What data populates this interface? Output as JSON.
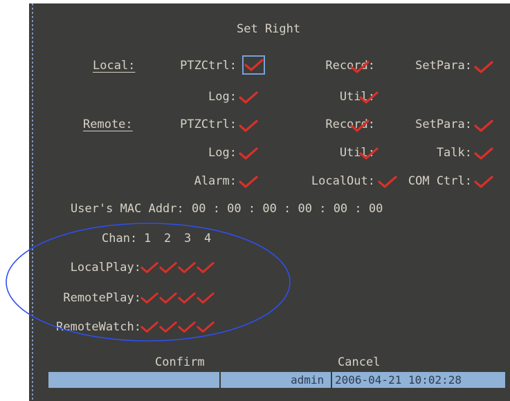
{
  "title": "Set Right",
  "local": {
    "label": "Local:",
    "ptz": "PTZCtrl:",
    "record": "Record:",
    "setpara": "SetPara:",
    "log": "Log:",
    "util": "Util:"
  },
  "remote": {
    "label": "Remote:",
    "ptz": "PTZCtrl:",
    "record": "Record:",
    "setpara": "SetPara:",
    "log": "Log:",
    "util": "Util:",
    "talk": "Talk:",
    "alarm": "Alarm:",
    "localout": "LocalOut:",
    "comctrl": "COM Ctrl:"
  },
  "mac": {
    "label": "User's MAC Addr:",
    "value": "00 : 00 : 00 : 00 : 00 : 00"
  },
  "channels": {
    "label": "Chan:",
    "numbers": [
      "1",
      "2",
      "3",
      "4"
    ]
  },
  "play_rows": [
    {
      "label": "LocalPlay:"
    },
    {
      "label": "RemotePlay:"
    },
    {
      "label": "RemoteWatch:"
    }
  ],
  "buttons": {
    "confirm": "Confirm",
    "cancel": "Cancel"
  },
  "status": {
    "user": "admin",
    "datetime": "2006-04-21 10:02:28"
  },
  "colors": {
    "background": "#3c3c3a",
    "text": "#d6d2c6",
    "check": "#d9302a",
    "status_bar": "#8fb2d6",
    "highlight_ellipse": "#2f4ff0"
  },
  "icons": {
    "check": "check-icon"
  }
}
